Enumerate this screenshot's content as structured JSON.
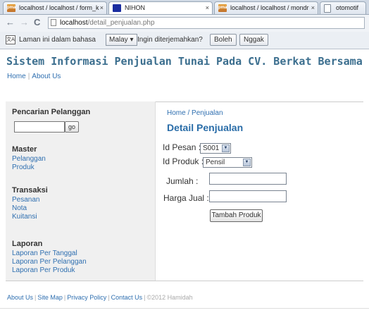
{
  "tabs": [
    {
      "label": "localhost / localhost / form_k",
      "icon": "phpmyadmin-icon",
      "close": "×"
    },
    {
      "label": "NIHON",
      "icon": "site-icon",
      "close": "×"
    },
    {
      "label": "localhost / localhost / mondr",
      "icon": "phpmyadmin-icon",
      "close": "×"
    },
    {
      "label": "otomotif",
      "icon": "page-icon",
      "close": ""
    }
  ],
  "toolbar": {
    "back": "←",
    "forward": "→",
    "reload": "C",
    "url_host": "localhost",
    "url_path": "/detail_penjualan.php"
  },
  "translate_bar": {
    "prompt": "Laman ini dalam bahasa",
    "language": "Malay",
    "question": "Ingin diterjemahkan?",
    "yes_label": "Boleh",
    "no_label": "Nggak"
  },
  "site": {
    "title": "Sistem Informasi Penjualan Tunai Pada CV. Berkat Bersama",
    "nav_home": "Home",
    "nav_sep": "|",
    "nav_about": "About Us"
  },
  "sidebar": {
    "search_heading": "Pencarian Pelanggan",
    "go_label": "go",
    "master_heading": "Master",
    "master_items": [
      "Pelanggan",
      "Produk"
    ],
    "transaksi_heading": "Transaksi",
    "transaksi_items": [
      "Pesanan",
      "Nota",
      "Kuitansi"
    ],
    "laporan_heading": "Laporan",
    "laporan_items": [
      "Laporan Per Tanggal",
      "Laporan Per Pelanggan",
      "Laporan Per Produk"
    ]
  },
  "main": {
    "crumb_home": "Home",
    "crumb_sep": " / ",
    "crumb_current": "Penjualan",
    "title": "Detail Penjualan",
    "id_pesan_label": "Id Pesan :",
    "id_pesan_value": "S001",
    "id_produk_label": "Id Produk :",
    "id_produk_value": "Pensil",
    "jumlah_label": "Jumlah :",
    "harga_label": "Harga Jual :",
    "add_button": "Tambah Produk"
  },
  "footer": {
    "about": "About Us",
    "sitemap": "Site Map",
    "privacy": "Privacy Policy",
    "contact": "Contact Us",
    "sep": "|",
    "copyright": "©2012 Hamidah"
  }
}
